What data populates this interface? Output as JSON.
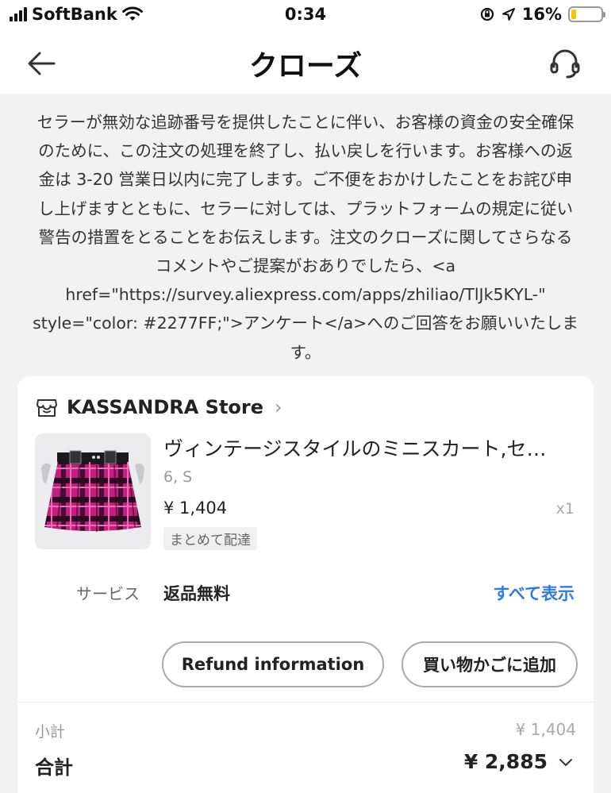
{
  "status_bar": {
    "carrier": "SoftBank",
    "time": "0:34",
    "battery_percent": "16%",
    "battery_level": 0.16,
    "battery_color": "#f5c400"
  },
  "nav": {
    "back_icon": "arrow-left-icon",
    "title": "クローズ",
    "support_icon": "headset-icon"
  },
  "notice": {
    "text": "セラーが無効な追跡番号を提供したことに伴い、お客様の資金の安全確保のために、この注文の処理を終了し、払い戻しを行います。お客様への返金は 3-20 営業日以内に完了します。ご不便をおかけしたことをお詫び申し上げますとともに、セラーに対しては、プラットフォームの規定に従い警告の措置をとることをお伝えします。注文のクローズに関してさらなるコメントやご提案がおありでしたら、<a href=\"https://survey.aliexpress.com/apps/zhiliao/TlJk5KYL-\" style=\"color: #2277FF;\">アンケート</a>へのご回答をお願いいたします。"
  },
  "order": {
    "store_icon": "store-icon",
    "store_name": "KASSANDRA Store",
    "product": {
      "title": "ヴィンテージスタイルのミニスカート,セ…",
      "variant": "6, S",
      "price": "¥ 1,404",
      "quantity": "x1",
      "tag": "まとめて配達"
    },
    "service": {
      "label": "サービス",
      "value": "返品無料",
      "link": "すべて表示",
      "link_color": "#2d7ae8"
    },
    "buttons": {
      "refund": "Refund information",
      "add_to_cart": "買い物かごに追加"
    }
  },
  "totals": {
    "subtotal_label": "小計",
    "subtotal_value": "¥ 1,404",
    "total_label": "合計",
    "total_value": "¥ 2,885"
  }
}
